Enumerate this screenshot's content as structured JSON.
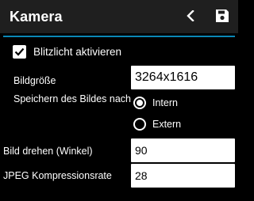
{
  "header": {
    "title": "Kamera",
    "back_icon": "chevron-left-icon",
    "save_icon": "save-icon"
  },
  "colors": {
    "accent": "#0a88b6",
    "toolbar_bg": "#1f1f1f",
    "background": "#000000"
  },
  "flash": {
    "label": "Blitzlicht aktivieren",
    "checked": true
  },
  "image_size": {
    "label": "Bildgröße",
    "value": "3264x1616"
  },
  "storage": {
    "label": "Speichern des Bildes nach",
    "options": [
      {
        "label": "Intern",
        "selected": true
      },
      {
        "label": "Extern",
        "selected": false
      }
    ]
  },
  "rotation": {
    "label": "Bild drehen (Winkel)",
    "value": "90"
  },
  "jpeg": {
    "label": "JPEG Kompressionsrate",
    "value": "28"
  }
}
